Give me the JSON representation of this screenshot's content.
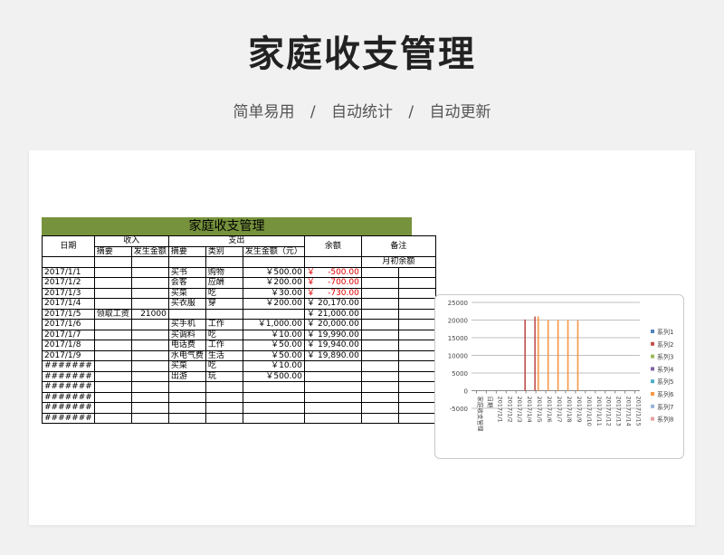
{
  "page": {
    "title": "家庭收支管理",
    "features": [
      "简单易用",
      "自动统计",
      "自动更新"
    ],
    "separator": "/"
  },
  "sheet": {
    "title": "家庭收支管理",
    "header": {
      "date": "日期",
      "income": "收入",
      "expense": "支出",
      "balance": "余额",
      "remark": "备注",
      "income_summary": "摘要",
      "income_amount": "发生金额",
      "expense_summary": "摘要",
      "expense_category": "类别",
      "expense_amount": "发生金额（元）"
    },
    "opening_label": "月初余额",
    "currency": "￥",
    "rows": [
      {
        "date": "2017/1/1",
        "inc_sum": "",
        "inc_amt": "",
        "exp_sum": "买书",
        "exp_cat": "购物",
        "exp_amt": "￥500.00",
        "bal": "-500.00",
        "neg": true
      },
      {
        "date": "2017/1/2",
        "inc_sum": "",
        "inc_amt": "",
        "exp_sum": "会客",
        "exp_cat": "应酬",
        "exp_amt": "￥200.00",
        "bal": "-700.00",
        "neg": true
      },
      {
        "date": "2017/1/3",
        "inc_sum": "",
        "inc_amt": "",
        "exp_sum": "买菜",
        "exp_cat": "吃",
        "exp_amt": "￥30.00",
        "bal": "-730.00",
        "neg": true
      },
      {
        "date": "2017/1/4",
        "inc_sum": "",
        "inc_amt": "",
        "exp_sum": "买衣服",
        "exp_cat": "穿",
        "exp_amt": "￥200.00",
        "bal": "20,170.00",
        "neg": false
      },
      {
        "date": "2017/1/5",
        "inc_sum": "领取工资",
        "inc_amt": "21000",
        "exp_sum": "",
        "exp_cat": "",
        "exp_amt": "",
        "bal": "21,000.00",
        "neg": false
      },
      {
        "date": "2017/1/6",
        "inc_sum": "",
        "inc_amt": "",
        "exp_sum": "买手机",
        "exp_cat": "工作",
        "exp_amt": "￥1,000.00",
        "bal": "20,000.00",
        "neg": false
      },
      {
        "date": "2017/1/7",
        "inc_sum": "",
        "inc_amt": "",
        "exp_sum": "买调料",
        "exp_cat": "吃",
        "exp_amt": "￥10.00",
        "bal": "19,990.00",
        "neg": false
      },
      {
        "date": "2017/1/8",
        "inc_sum": "",
        "inc_amt": "",
        "exp_sum": "电话费",
        "exp_cat": "工作",
        "exp_amt": "￥50.00",
        "bal": "19,940.00",
        "neg": false
      },
      {
        "date": "2017/1/9",
        "inc_sum": "",
        "inc_amt": "",
        "exp_sum": "水电气费",
        "exp_cat": "生活",
        "exp_amt": "￥50.00",
        "bal": "19,890.00",
        "neg": false
      },
      {
        "date": "#######",
        "inc_sum": "",
        "inc_amt": "",
        "exp_sum": "买菜",
        "exp_cat": "吃",
        "exp_amt": "￥10.00",
        "bal": "",
        "neg": false
      },
      {
        "date": "#######",
        "inc_sum": "",
        "inc_amt": "",
        "exp_sum": "出游",
        "exp_cat": "玩",
        "exp_amt": "￥500.00",
        "bal": "",
        "neg": false
      },
      {
        "date": "#######",
        "inc_sum": "",
        "inc_amt": "",
        "exp_sum": "",
        "exp_cat": "",
        "exp_amt": "",
        "bal": "",
        "neg": false
      },
      {
        "date": "#######",
        "inc_sum": "",
        "inc_amt": "",
        "exp_sum": "",
        "exp_cat": "",
        "exp_amt": "",
        "bal": "",
        "neg": false
      },
      {
        "date": "#######",
        "inc_sum": "",
        "inc_amt": "",
        "exp_sum": "",
        "exp_cat": "",
        "exp_amt": "",
        "bal": "",
        "neg": false
      },
      {
        "date": "#######",
        "inc_sum": "",
        "inc_amt": "",
        "exp_sum": "",
        "exp_cat": "",
        "exp_amt": "",
        "bal": "",
        "neg": false
      }
    ]
  },
  "chart_data": {
    "type": "bar",
    "ylim": [
      -5000,
      25000
    ],
    "yticks": [
      "25000",
      "20000",
      "15000",
      "10000",
      "5000",
      "0",
      "-5000"
    ],
    "ytick_values": [
      25000,
      20000,
      15000,
      10000,
      5000,
      0,
      -5000
    ],
    "categories": [
      "家庭收支管理",
      "日期",
      "2017/1/1",
      "2017/1/2",
      "2017/1/3",
      "2017/1/4",
      "2017/1/5",
      "2017/1/6",
      "2017/1/7",
      "2017/1/8",
      "2017/1/9",
      "2017/1/10",
      "2017/1/11",
      "2017/1/12",
      "2017/1/13",
      "2017/1/14",
      "2017/1/15"
    ],
    "legend": [
      "系列1",
      "系列2",
      "系列3",
      "系列4",
      "系列5",
      "系列6",
      "系列7",
      "系列8"
    ],
    "legend_colors": [
      "#4f81bd",
      "#c0504d",
      "#9bbb59",
      "#8064a2",
      "#4bacc6",
      "#f79646",
      "#95b3d7",
      "#e6a0a0"
    ],
    "legend_position": "right",
    "grid": true,
    "bars": [
      {
        "category": "2017/1/4",
        "series": 2,
        "value": 20170
      },
      {
        "category": "2017/1/5",
        "series": 2,
        "value": 21000
      },
      {
        "category": "2017/1/5",
        "series": 6,
        "value": 21000
      },
      {
        "category": "2017/1/6",
        "series": 6,
        "value": 20000
      },
      {
        "category": "2017/1/7",
        "series": 6,
        "value": 19990
      },
      {
        "category": "2017/1/8",
        "series": 6,
        "value": 19940
      },
      {
        "category": "2017/1/9",
        "series": 6,
        "value": 19890
      }
    ]
  }
}
